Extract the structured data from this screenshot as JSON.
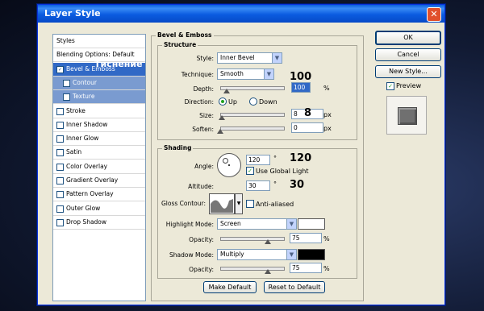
{
  "window": {
    "title": "Layer Style",
    "close_glyph": "✕"
  },
  "left_panel": {
    "items": [
      {
        "label": "Styles",
        "checkbox": false,
        "state": "normal",
        "header": true
      },
      {
        "label": "Blending Options: Default",
        "checkbox": false,
        "state": "normal",
        "header": true
      },
      {
        "label": "Bevel & Emboss",
        "checkbox": true,
        "checked": true,
        "state": "selected"
      },
      {
        "label": "Contour",
        "checkbox": true,
        "checked": false,
        "state": "sub"
      },
      {
        "label": "Texture",
        "checkbox": true,
        "checked": false,
        "state": "sub"
      },
      {
        "label": "Stroke",
        "checkbox": true,
        "checked": false,
        "state": "normal"
      },
      {
        "label": "Inner Shadow",
        "checkbox": true,
        "checked": false,
        "state": "normal"
      },
      {
        "label": "Inner Glow",
        "checkbox": true,
        "checked": false,
        "state": "normal"
      },
      {
        "label": "Satin",
        "checkbox": true,
        "checked": false,
        "state": "normal"
      },
      {
        "label": "Color Overlay",
        "checkbox": true,
        "checked": false,
        "state": "normal"
      },
      {
        "label": "Gradient Overlay",
        "checkbox": true,
        "checked": false,
        "state": "normal"
      },
      {
        "label": "Pattern Overlay",
        "checkbox": true,
        "checked": false,
        "state": "normal"
      },
      {
        "label": "Outer Glow",
        "checkbox": true,
        "checked": false,
        "state": "normal"
      },
      {
        "label": "Drop Shadow",
        "checkbox": true,
        "checked": false,
        "state": "normal"
      }
    ],
    "overlay_annotation": "Тиснение"
  },
  "bevel": {
    "group_title": "Bevel & Emboss",
    "structure_title": "Structure",
    "style_label": "Style:",
    "style_value": "Inner Bevel",
    "technique_label": "Technique:",
    "technique_value": "Smooth",
    "depth_label": "Depth:",
    "depth_value": "100",
    "depth_unit": "%",
    "depth_level": 0.1,
    "direction_label": "Direction:",
    "direction_up": "Up",
    "direction_down": "Down",
    "size_label": "Size:",
    "size_value": "8",
    "size_unit": "px",
    "size_level": 0.03,
    "soften_label": "Soften:",
    "soften_value": "0",
    "soften_unit": "px",
    "soften_level": 0.0
  },
  "shading": {
    "title": "Shading",
    "angle_label": "Angle:",
    "angle_value": "120",
    "angle_unit": "°",
    "use_global_light": "Use Global Light",
    "altitude_label": "Altitude:",
    "altitude_value": "30",
    "altitude_unit": "°",
    "gloss_label": "Gloss Contour:",
    "anti_aliased": "Anti-aliased",
    "highlight_mode_label": "Highlight Mode:",
    "highlight_mode_value": "Screen",
    "highlight_color": "#ffffff",
    "hl_opacity_label": "Opacity:",
    "hl_opacity_value": "75",
    "hl_opacity_unit": "%",
    "hl_opacity_level": 0.75,
    "shadow_mode_label": "Shadow Mode:",
    "shadow_mode_value": "Multiply",
    "shadow_color": "#000000",
    "sh_opacity_label": "Opacity:",
    "sh_opacity_value": "75",
    "sh_opacity_unit": "%",
    "sh_opacity_level": 0.75
  },
  "buttons": {
    "make_default": "Make Default",
    "reset_default": "Reset to Default",
    "ok": "OK",
    "cancel": "Cancel",
    "new_style": "New Style...",
    "preview": "Preview"
  },
  "annotations": {
    "depth": "100",
    "size": "8",
    "angle": "120",
    "altitude": "30"
  },
  "colors": {
    "selected": "#3169c6",
    "titlebar": "#0a5fdc"
  }
}
